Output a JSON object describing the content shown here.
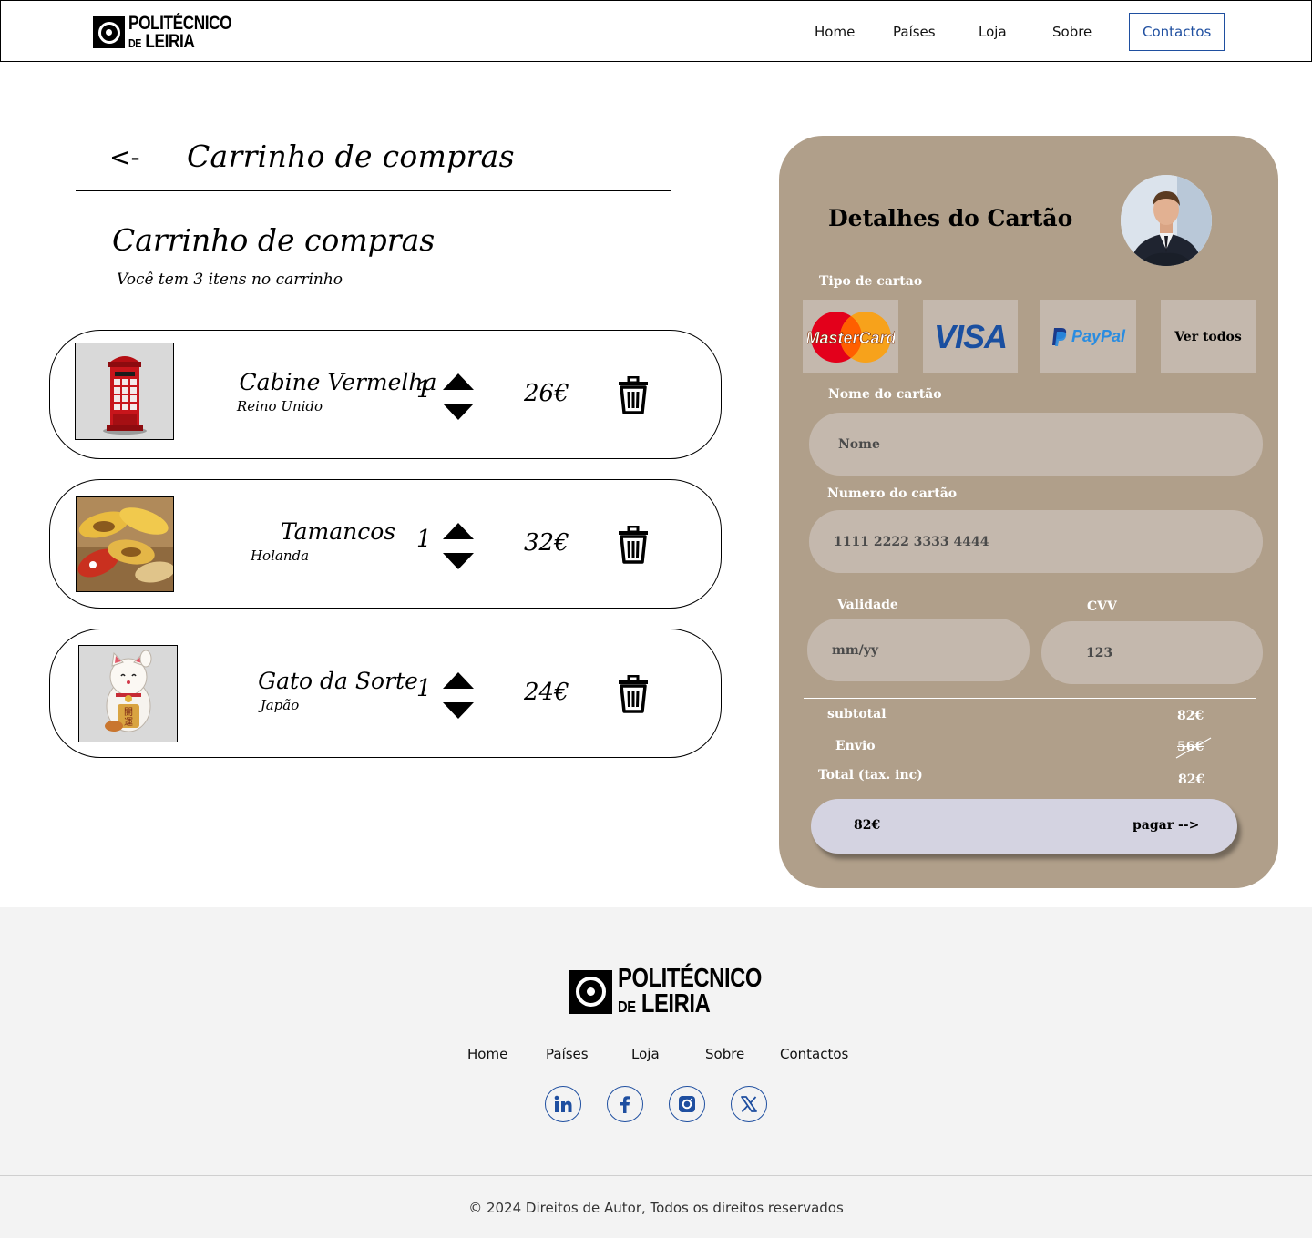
{
  "header": {
    "logo": {
      "line1": "POLITÉCNICO",
      "line2_small": "DE",
      "line2": "LEIRIA"
    },
    "nav": [
      {
        "label": "Home"
      },
      {
        "label": "Países"
      },
      {
        "label": "Loja"
      },
      {
        "label": "Sobre"
      },
      {
        "label": "Contactos"
      }
    ]
  },
  "cart": {
    "back": "<-",
    "heading": "Carrinho de compras",
    "title": "Carrinho de compras",
    "subtitle": "Você tem 3 itens no carrinho",
    "items": [
      {
        "name": "Cabine Vermelha",
        "origin": "Reino Unido",
        "qty": "1",
        "price": "26€"
      },
      {
        "name": "Tamancos",
        "origin": "Holanda",
        "qty": "1",
        "price": "32€"
      },
      {
        "name": "Gato da Sorte",
        "origin": "Japão",
        "qty": "1",
        "price": "24€"
      }
    ]
  },
  "card": {
    "title": "Detalhes do Cartão",
    "type_label": "Tipo de cartao",
    "types": {
      "mastercard": "MasterCard",
      "visa": "VISA",
      "paypal": "PayPal",
      "all": "Ver todos"
    },
    "name_label": "Nome do cartão",
    "name_placeholder": "Nome",
    "number_label": "Numero do cartão",
    "number_value": "1111 2222 3333 4444",
    "validity_label": "Validade",
    "validity_placeholder": "mm/yy",
    "cvv_label": "CVV",
    "cvv_value": "123",
    "subtotal_label": "subtotal",
    "subtotal_value": "82€",
    "shipping_label": "Envio",
    "shipping_value": "56€",
    "total_label": "Total (tax. inc)",
    "total_value": "82€",
    "pay_amount": "82€",
    "pay_label": "pagar -->"
  },
  "footer": {
    "logo": {
      "line1": "POLITÉCNICO",
      "line2_small": "DE",
      "line2": "LEIRIA"
    },
    "links": [
      {
        "label": "Home"
      },
      {
        "label": "Países"
      },
      {
        "label": "Loja"
      },
      {
        "label": "Sobre"
      },
      {
        "label": "Contactos"
      }
    ],
    "social": [
      "linkedin-icon",
      "facebook-icon",
      "instagram-icon",
      "x-icon"
    ],
    "copyright": "© 2024 Direitos de Autor, Todos os direitos reservados"
  },
  "colors": {
    "panel": "#b09f8a",
    "field": "#c4b8ad",
    "pay_button": "#d4d3e1",
    "link_blue": "#1f4fa0",
    "footer_bg": "#f3f3f3"
  }
}
